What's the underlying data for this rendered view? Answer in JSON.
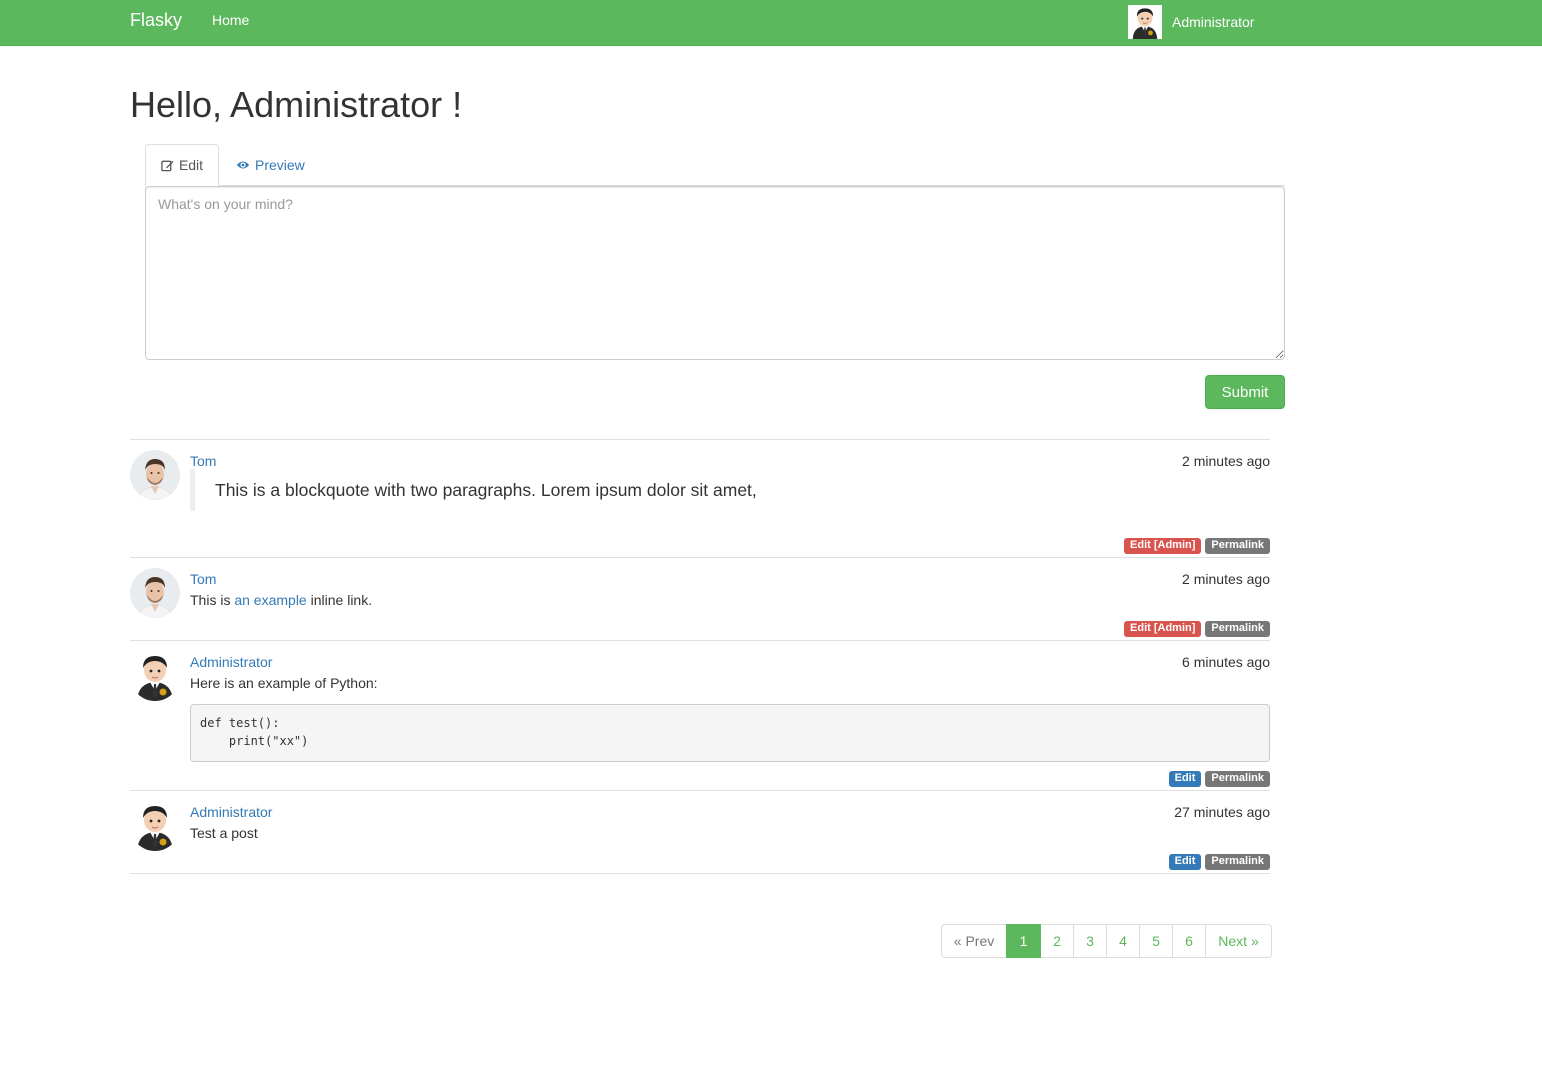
{
  "navbar": {
    "brand": "Flasky",
    "home": "Home",
    "user": "Administrator",
    "user_avatar_icon": "admin-avatar-icon"
  },
  "page_title": "Hello, Administrator !",
  "editor": {
    "tabs": [
      "Edit",
      "Preview"
    ],
    "tab_icons": [
      "edit-icon",
      "eye-icon"
    ],
    "placeholder": "What's on your mind?",
    "submit_label": "Submit"
  },
  "posts": [
    {
      "author": "Tom",
      "avatar_icon": "tom-avatar",
      "date": "2 minutes ago",
      "blockquote": "This is a blockquote with two paragraphs. Lorem ipsum dolor sit amet,",
      "actions": [
        "Edit [Admin]",
        "Permalink"
      ]
    },
    {
      "author": "Tom",
      "avatar_icon": "tom-avatar",
      "date": "2 minutes ago",
      "text_before": "This is ",
      "link_text": "an example",
      "text_after": " inline link.",
      "actions": [
        "Edit [Admin]",
        "Permalink"
      ]
    },
    {
      "author": "Administrator",
      "avatar_icon": "admin-avatar",
      "date": "6 minutes ago",
      "text": "Here is an example of Python:",
      "code": "def test():\n    print(\"xx\")",
      "actions": [
        "Edit",
        "Permalink"
      ]
    },
    {
      "author": "Administrator",
      "avatar_icon": "admin-avatar",
      "date": "27 minutes ago",
      "text": "Test a post",
      "actions": [
        "Edit",
        "Permalink"
      ]
    }
  ],
  "colors": {
    "navbar": "#5cb85c",
    "link": "#337ab7",
    "danger": "#d9534f",
    "primary": "#337ab7",
    "default": "#777777"
  },
  "pagination": {
    "prev": "« Prev",
    "pages": [
      "1",
      "2",
      "3",
      "4",
      "5",
      "6"
    ],
    "active": "1",
    "next": "Next »"
  }
}
